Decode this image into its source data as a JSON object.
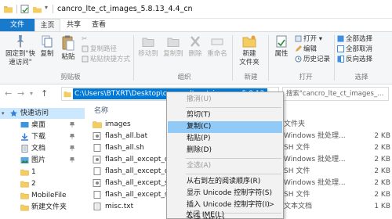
{
  "window": {
    "title": "cancro_lte_ct_images_5.8.13_4.4_cn"
  },
  "tabs": [
    {
      "label": "文件"
    },
    {
      "label": "主页"
    },
    {
      "label": "共享"
    },
    {
      "label": "查看"
    }
  ],
  "ribbon": {
    "clipboard": {
      "pin_label": "固定到\"快\n速访问\"",
      "copy_label": "复制",
      "paste_label": "粘贴",
      "copy_path_label": "复制路径",
      "paste_shortcut_label": "粘贴快捷方式",
      "cut_label": "",
      "group_label": "剪贴板"
    },
    "organize": {
      "move_to_label": "移动到",
      "copy_to_label": "复制到",
      "delete_label": "删除",
      "rename_label": "重命名",
      "group_label": "组织"
    },
    "new": {
      "new_folder_label": "新建\n文件夹",
      "group_label": "新建"
    },
    "open": {
      "properties_label": "属性",
      "open_label": "打开 ▾",
      "edit_label": "编辑",
      "history_label": "历史记录",
      "group_label": "打开"
    },
    "select": {
      "select_all_label": "全部选择",
      "select_none_label": "全部取消",
      "invert_label": "反向选择",
      "group_label": "选择"
    }
  },
  "address_bar": {
    "back_arrow": "←",
    "forward_arrow": "→",
    "up_arrow": "↑",
    "path": "C:\\Users\\BTXRT\\Desktop\\cancro_lte_ct_images_5.8.13_2015072",
    "search_placeholder": "搜索\"cancro_lte_ct_images_..."
  },
  "nav_pane": {
    "items": [
      {
        "label": "快速访问",
        "icon": "star-icon",
        "selected": true,
        "pinned": false
      },
      {
        "label": "桌面",
        "icon": "desktop-icon",
        "selected": false,
        "pinned": true
      },
      {
        "label": "下载",
        "icon": "download-icon",
        "selected": false,
        "pinned": true
      },
      {
        "label": "文档",
        "icon": "documents-icon",
        "selected": false,
        "pinned": true
      },
      {
        "label": "图片",
        "icon": "pictures-icon",
        "selected": false,
        "pinned": true
      },
      {
        "label": "1",
        "icon": "folder-icon",
        "selected": false,
        "pinned": false
      },
      {
        "label": "2",
        "icon": "folder-icon",
        "selected": false,
        "pinned": false
      },
      {
        "label": "MobileFile",
        "icon": "folder-icon",
        "selected": false,
        "pinned": false
      },
      {
        "label": "新建文件夹",
        "icon": "folder-icon",
        "selected": false,
        "pinned": false
      }
    ]
  },
  "file_list": {
    "name_header": "名称",
    "rows": [
      {
        "name": "images",
        "type": "文件夹",
        "size": "",
        "icon": "folder-icon"
      },
      {
        "name": "flash_all.bat",
        "type": "Windows 批处理...",
        "size": "2 KB",
        "icon": "bat-file-icon"
      },
      {
        "name": "flash_all.sh",
        "type": "SH 文件",
        "size": "2 KB",
        "icon": "file-icon"
      },
      {
        "name": "flash_all_except_data_s",
        "type": "Windows 批处理...",
        "size": "2 KB",
        "icon": "bat-file-icon"
      },
      {
        "name": "flash_all_except_data_s",
        "type": "SH 文件",
        "size": "2 KB",
        "icon": "file-icon"
      },
      {
        "name": "flash_all_except_storag",
        "type": "Windows 批处理...",
        "size": "2 KB",
        "icon": "bat-file-icon"
      },
      {
        "name": "flash_all_except_storag",
        "type": "SH 文件",
        "size": "2 KB",
        "icon": "file-icon"
      },
      {
        "name": "misc.txt",
        "type": "文本文档",
        "size": "1 KB",
        "icon": "text-file-icon"
      }
    ]
  },
  "context_menu": {
    "undo": "撤消(U)",
    "cut": "剪切(T)",
    "copy": "复制(C)",
    "paste": "粘贴(P)",
    "delete": "删除(D)",
    "select_all": "全选(A)",
    "rtl": "从右到左的阅读顺序(R)",
    "show_unicode": "显示 Unicode 控制字符(S)",
    "insert_unicode": "插入 Unicode 控制字符(I)",
    "close_ime": "关闭 IME(L)",
    "submenu_arrow": ">"
  }
}
